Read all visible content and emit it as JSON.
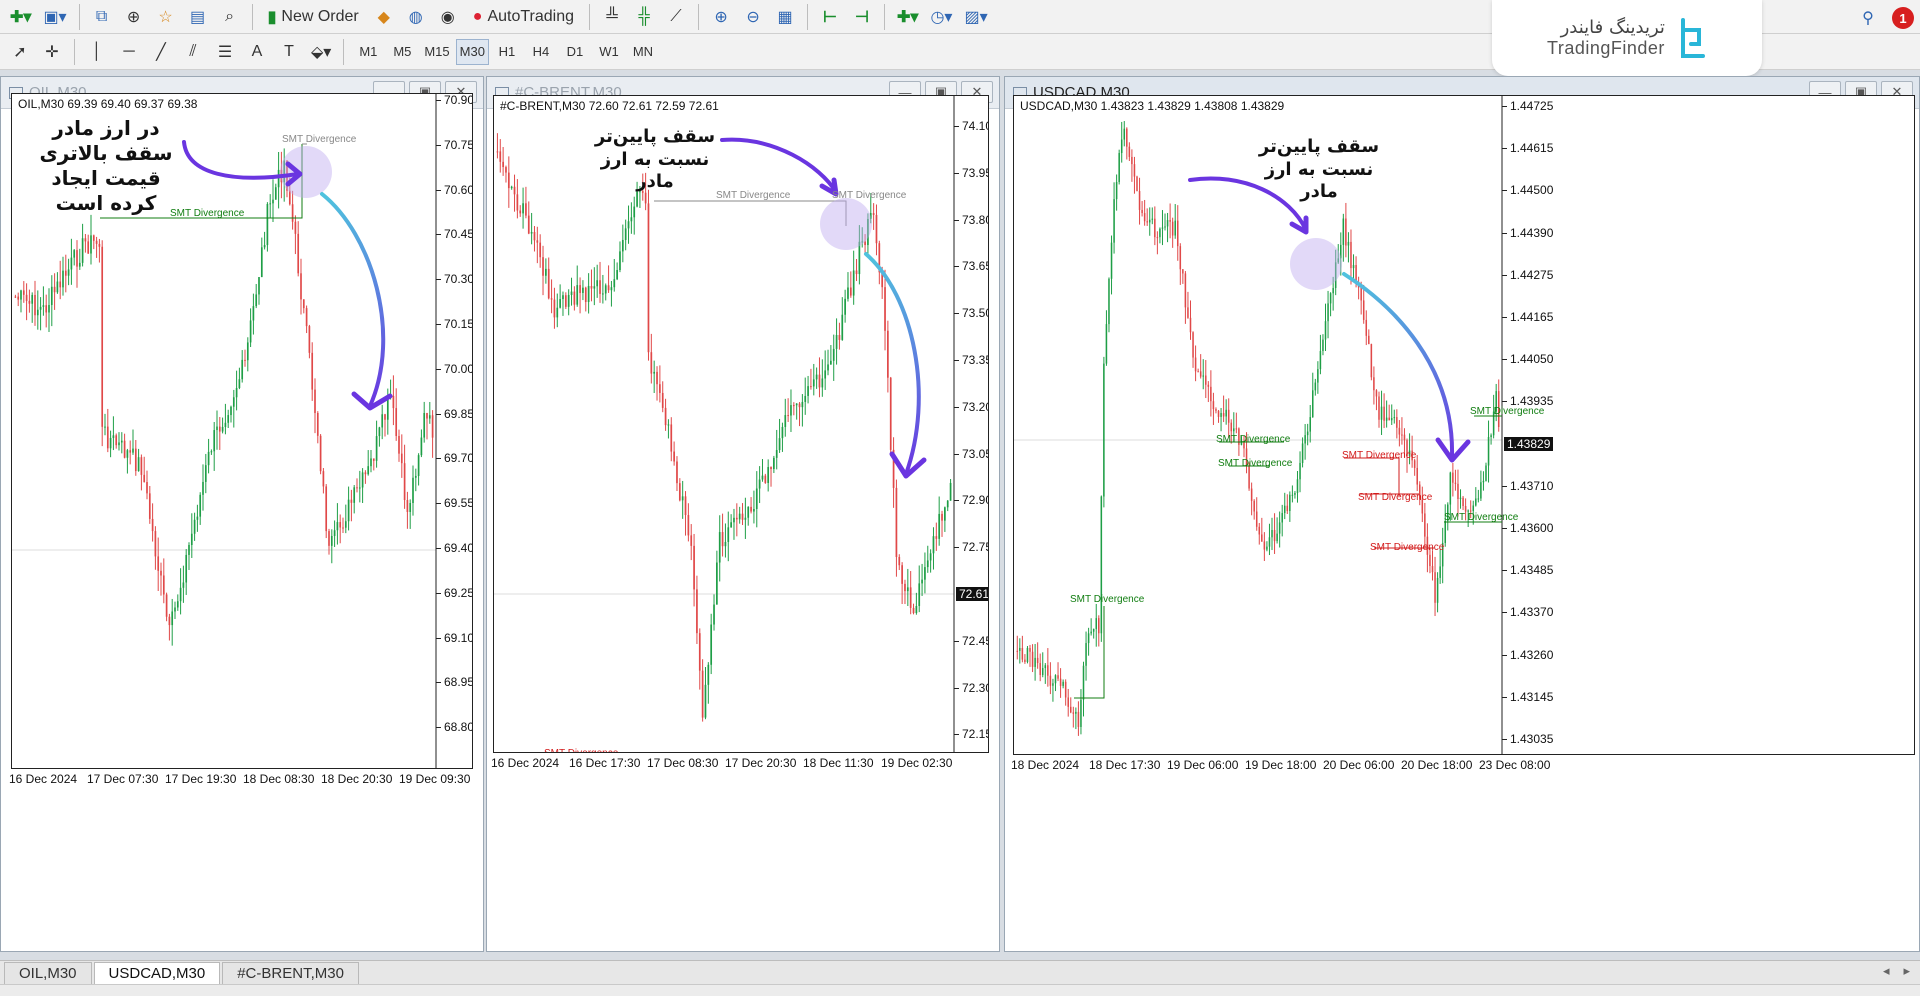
{
  "toolbar": {
    "new_order": "New Order",
    "autotrading": "AutoTrading",
    "timeframes": [
      "M1",
      "M5",
      "M15",
      "M30",
      "H1",
      "H4",
      "D1",
      "W1",
      "MN"
    ],
    "active_timeframe": "M30"
  },
  "brand": {
    "name_fa": "تریدینگ فایندر",
    "name_en": "TradingFinder"
  },
  "notification_count": "1",
  "windows": [
    {
      "title": "OIL,M30",
      "ohlc": "OIL,M30  69.39 69.40 69.37 69.38",
      "y_ticks": [
        "70.90",
        "70.75",
        "70.60",
        "70.45",
        "70.30",
        "70.15",
        "70.00",
        "69.85",
        "69.70",
        "69.55",
        "69.40",
        "69.25",
        "69.10",
        "68.95",
        "68.80"
      ],
      "current_price": "69.38",
      "x_ticks": [
        "16 Dec 2024",
        "17 Dec 07:30",
        "17 Dec 19:30",
        "18 Dec 08:30",
        "18 Dec 20:30",
        "19 Dec 09:30"
      ],
      "smt_labels": [
        "SMT Divergence",
        "SMT Divergence"
      ],
      "annotation": "در ارز مادر سقف بالاتری قیمت ایجاد کرده است"
    },
    {
      "title": "#C-BRENT,M30",
      "ohlc": "#C-BRENT,M30  72.60 72.61 72.59 72.61",
      "y_ticks": [
        "74.10",
        "73.95",
        "73.80",
        "73.65",
        "73.50",
        "73.35",
        "73.20",
        "73.05",
        "72.90",
        "72.75",
        "72.61",
        "72.45",
        "72.30",
        "72.15"
      ],
      "current_price": "72.61",
      "x_ticks": [
        "16 Dec 2024",
        "16 Dec 17:30",
        "17 Dec 08:30",
        "17 Dec 20:30",
        "18 Dec 11:30",
        "19 Dec 02:30"
      ],
      "smt_labels": [
        "SMT Divergence",
        "SMT Divergence",
        "SMT Divergence"
      ],
      "annotation": "سقف پایین‌تر نسبت به ارز مادر"
    },
    {
      "title": "USDCAD,M30",
      "ohlc": "USDCAD,M30  1.43823 1.43829 1.43808 1.43829",
      "y_ticks": [
        "1.44725",
        "1.44615",
        "1.44500",
        "1.44390",
        "1.44275",
        "1.44165",
        "1.44050",
        "1.43935",
        "1.43829",
        "1.43710",
        "1.43600",
        "1.43485",
        "1.43370",
        "1.43260",
        "1.43145",
        "1.43035"
      ],
      "current_price": "1.43829",
      "x_ticks": [
        "18 Dec 2024",
        "18 Dec 17:30",
        "19 Dec 06:00",
        "19 Dec 18:00",
        "20 Dec 06:00",
        "20 Dec 18:00",
        "23 Dec 08:00"
      ],
      "smt_labels": [
        "SMT Divergence",
        "SMT Divergence",
        "SMT Divergence",
        "SMT Divergence",
        "SMT Divergence",
        "SMT Divergence",
        "SMT Divergence",
        "SMT Divergence"
      ],
      "annotation": "سقف پایین‌تر نسبت به ارز مادر"
    }
  ],
  "tabs": [
    "OIL,M30",
    "USDCAD,M30",
    "#C-BRENT,M30"
  ],
  "active_tab": "USDCAD,M30",
  "colors": {
    "bull": "#1e9e46",
    "bear": "#e04848",
    "smt_green": "#107d10",
    "smt_red": "#d21b1b",
    "arrow_purple": "#6a35e0",
    "arrow_cyan": "#4fc3de"
  }
}
